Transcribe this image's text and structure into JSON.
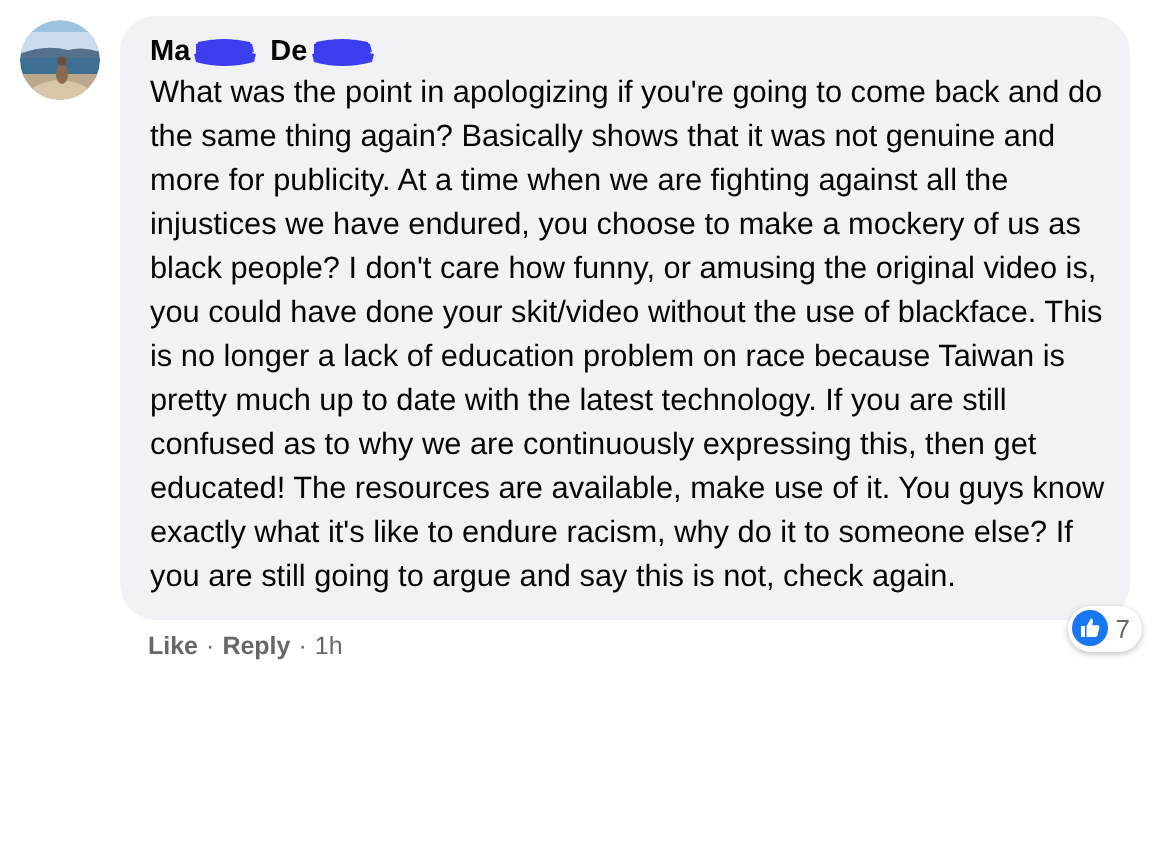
{
  "comment": {
    "avatar": {
      "kind": "picture"
    },
    "author_parts": [
      "Ma",
      "De"
    ],
    "text": "What was the point in apologizing if you're going to come back and do the same thing again? Basically shows that it was not genuine and more for publicity. At a time when we are fighting against all the injustices we have endured, you choose to make a mockery of us as black people? I don't care how funny, or amusing the original video is, you could have done your skit/video without the use of blackface. This is no longer a lack of education problem on race because Taiwan is pretty much up to date with the latest technology. If you are still confused as to why we are continuously expressing this, then get educated! The resources are available, make use of it. You guys know exactly what it's like to endure racism, why do it to someone else? If you are still going to argue and say this is not, check again.",
    "reactions": {
      "count": "7"
    },
    "actions": [
      {
        "label": "Like",
        "kind": "link"
      },
      {
        "label": "Reply",
        "kind": "link"
      },
      {
        "label": "1h",
        "kind": "time"
      }
    ],
    "separator": "·"
  }
}
